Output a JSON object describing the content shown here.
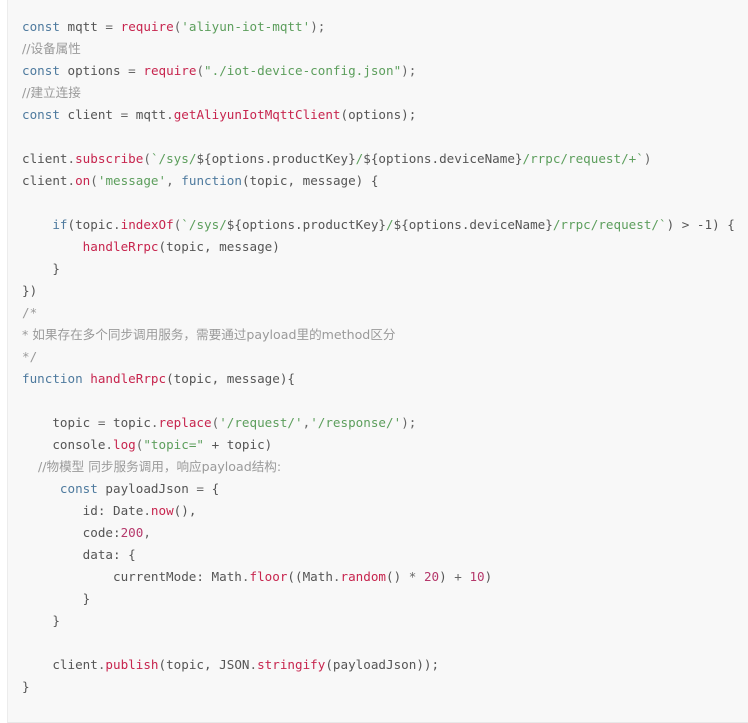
{
  "block": {
    "name": "javascript-code-block",
    "language": "javascript",
    "background": "#f8f8f8",
    "colors": {
      "keyword": "#4e7a9e",
      "function": "#c7254e",
      "string": "#5c9e5c",
      "number": "#b5386b",
      "comment": "#9a9a9a",
      "plain": "#555555"
    }
  },
  "code": {
    "lines": [
      {
        "n": 1,
        "tokens": [
          {
            "t": "const",
            "c": "kw"
          },
          {
            "t": " mqtt ",
            "c": "pl"
          },
          {
            "t": "=",
            "c": "pun"
          },
          {
            "t": " ",
            "c": "pl"
          },
          {
            "t": "require",
            "c": "fn"
          },
          {
            "t": "(",
            "c": "pun"
          },
          {
            "t": "'aliyun-iot-mqtt'",
            "c": "str"
          },
          {
            "t": ");",
            "c": "pun"
          }
        ]
      },
      {
        "n": 2,
        "tokens": [
          {
            "t": "//设备属性",
            "c": "cmt"
          }
        ]
      },
      {
        "n": 3,
        "tokens": [
          {
            "t": "const",
            "c": "kw"
          },
          {
            "t": " options ",
            "c": "pl"
          },
          {
            "t": "=",
            "c": "pun"
          },
          {
            "t": " ",
            "c": "pl"
          },
          {
            "t": "require",
            "c": "fn"
          },
          {
            "t": "(",
            "c": "pun"
          },
          {
            "t": "\"./iot-device-config.json\"",
            "c": "str"
          },
          {
            "t": ");",
            "c": "pun"
          }
        ]
      },
      {
        "n": 4,
        "tokens": [
          {
            "t": "//建立连接",
            "c": "cmt"
          }
        ]
      },
      {
        "n": 5,
        "tokens": [
          {
            "t": "const",
            "c": "kw"
          },
          {
            "t": " client ",
            "c": "pl"
          },
          {
            "t": "=",
            "c": "pun"
          },
          {
            "t": " mqtt",
            "c": "pl"
          },
          {
            "t": ".",
            "c": "pun"
          },
          {
            "t": "getAliyunIotMqttClient",
            "c": "fn"
          },
          {
            "t": "(options);",
            "c": "pl"
          }
        ]
      },
      {
        "n": 6,
        "tokens": []
      },
      {
        "n": 7,
        "tokens": [
          {
            "t": "client",
            "c": "pl"
          },
          {
            "t": ".",
            "c": "pun"
          },
          {
            "t": "subscribe",
            "c": "fn"
          },
          {
            "t": "(",
            "c": "pun"
          },
          {
            "t": "`/sys/",
            "c": "str"
          },
          {
            "t": "${options.productKey}",
            "c": "pl"
          },
          {
            "t": "/",
            "c": "str"
          },
          {
            "t": "${options.deviceName}",
            "c": "pl"
          },
          {
            "t": "/rrpc/request/+`",
            "c": "str"
          },
          {
            "t": ")",
            "c": "pun"
          }
        ]
      },
      {
        "n": 8,
        "tokens": [
          {
            "t": "client",
            "c": "pl"
          },
          {
            "t": ".",
            "c": "pun"
          },
          {
            "t": "on",
            "c": "fn"
          },
          {
            "t": "(",
            "c": "pun"
          },
          {
            "t": "'message'",
            "c": "str"
          },
          {
            "t": ", ",
            "c": "pun"
          },
          {
            "t": "function",
            "c": "kw"
          },
          {
            "t": "(topic, message) {",
            "c": "pl"
          }
        ]
      },
      {
        "n": 9,
        "tokens": []
      },
      {
        "n": 10,
        "tokens": [
          {
            "t": "    ",
            "c": "pl"
          },
          {
            "t": "if",
            "c": "kw"
          },
          {
            "t": "(topic",
            "c": "pl"
          },
          {
            "t": ".",
            "c": "pun"
          },
          {
            "t": "indexOf",
            "c": "fn"
          },
          {
            "t": "(",
            "c": "pun"
          },
          {
            "t": "`/sys/",
            "c": "str"
          },
          {
            "t": "${options.productKey}",
            "c": "pl"
          },
          {
            "t": "/",
            "c": "str"
          },
          {
            "t": "${options.deviceName}",
            "c": "pl"
          },
          {
            "t": "/rrpc/request/`",
            "c": "str"
          },
          {
            "t": ") > -1) {",
            "c": "pl"
          }
        ]
      },
      {
        "n": 11,
        "tokens": [
          {
            "t": "        ",
            "c": "pl"
          },
          {
            "t": "handleRrpc",
            "c": "fn"
          },
          {
            "t": "(topic, message)",
            "c": "pl"
          }
        ]
      },
      {
        "n": 12,
        "tokens": [
          {
            "t": "    }",
            "c": "pl"
          }
        ]
      },
      {
        "n": 13,
        "tokens": [
          {
            "t": "})",
            "c": "pl"
          }
        ]
      },
      {
        "n": 14,
        "tokens": [
          {
            "t": "/*",
            "c": "cmt"
          }
        ]
      },
      {
        "n": 15,
        "tokens": [
          {
            "t": "* 如果存在多个同步调用服务，需要通过payload里的method区分",
            "c": "cmt"
          }
        ]
      },
      {
        "n": 16,
        "tokens": [
          {
            "t": "*/",
            "c": "cmt"
          }
        ]
      },
      {
        "n": 17,
        "tokens": [
          {
            "t": "function",
            "c": "kw"
          },
          {
            "t": " ",
            "c": "pl"
          },
          {
            "t": "handleRrpc",
            "c": "fn"
          },
          {
            "t": "(topic, message){",
            "c": "pl"
          }
        ]
      },
      {
        "n": 18,
        "tokens": []
      },
      {
        "n": 19,
        "tokens": [
          {
            "t": "    topic ",
            "c": "pl"
          },
          {
            "t": "=",
            "c": "pun"
          },
          {
            "t": " topic",
            "c": "pl"
          },
          {
            "t": ".",
            "c": "pun"
          },
          {
            "t": "replace",
            "c": "fn"
          },
          {
            "t": "(",
            "c": "pun"
          },
          {
            "t": "'/request/'",
            "c": "str"
          },
          {
            "t": ",",
            "c": "pun"
          },
          {
            "t": "'/response/'",
            "c": "str"
          },
          {
            "t": ");",
            "c": "pun"
          }
        ]
      },
      {
        "n": 20,
        "tokens": [
          {
            "t": "    console",
            "c": "pl"
          },
          {
            "t": ".",
            "c": "pun"
          },
          {
            "t": "log",
            "c": "fn"
          },
          {
            "t": "(",
            "c": "pun"
          },
          {
            "t": "\"topic=\"",
            "c": "str"
          },
          {
            "t": " + topic)",
            "c": "pl"
          }
        ]
      },
      {
        "n": 21,
        "tokens": [
          {
            "t": "    //物模型 同步服务调用，响应payload结构:",
            "c": "cmt"
          }
        ]
      },
      {
        "n": 22,
        "tokens": [
          {
            "t": "     ",
            "c": "pl"
          },
          {
            "t": "const",
            "c": "kw"
          },
          {
            "t": " payloadJson ",
            "c": "pl"
          },
          {
            "t": "=",
            "c": "pun"
          },
          {
            "t": " {",
            "c": "pl"
          }
        ]
      },
      {
        "n": 23,
        "tokens": [
          {
            "t": "        id: Date",
            "c": "pl"
          },
          {
            "t": ".",
            "c": "pun"
          },
          {
            "t": "now",
            "c": "fn"
          },
          {
            "t": "(),",
            "c": "pl"
          }
        ]
      },
      {
        "n": 24,
        "tokens": [
          {
            "t": "        code:",
            "c": "pl"
          },
          {
            "t": "200",
            "c": "num"
          },
          {
            "t": ",",
            "c": "pun"
          }
        ]
      },
      {
        "n": 25,
        "tokens": [
          {
            "t": "        data: {",
            "c": "pl"
          }
        ]
      },
      {
        "n": 26,
        "tokens": [
          {
            "t": "            currentMode: Math",
            "c": "pl"
          },
          {
            "t": ".",
            "c": "pun"
          },
          {
            "t": "floor",
            "c": "fn"
          },
          {
            "t": "((Math",
            "c": "pl"
          },
          {
            "t": ".",
            "c": "pun"
          },
          {
            "t": "random",
            "c": "fn"
          },
          {
            "t": "() ",
            "c": "pl"
          },
          {
            "t": "*",
            "c": "pun"
          },
          {
            "t": " ",
            "c": "pl"
          },
          {
            "t": "20",
            "c": "num"
          },
          {
            "t": ") ",
            "c": "pl"
          },
          {
            "t": "+",
            "c": "pun"
          },
          {
            "t": " ",
            "c": "pl"
          },
          {
            "t": "10",
            "c": "num"
          },
          {
            "t": ")",
            "c": "pl"
          }
        ]
      },
      {
        "n": 27,
        "tokens": [
          {
            "t": "        }",
            "c": "pl"
          }
        ]
      },
      {
        "n": 28,
        "tokens": [
          {
            "t": "    }",
            "c": "pl"
          }
        ]
      },
      {
        "n": 29,
        "tokens": []
      },
      {
        "n": 30,
        "tokens": [
          {
            "t": "    client",
            "c": "pl"
          },
          {
            "t": ".",
            "c": "pun"
          },
          {
            "t": "publish",
            "c": "fn"
          },
          {
            "t": "(topic, JSON",
            "c": "pl"
          },
          {
            "t": ".",
            "c": "pun"
          },
          {
            "t": "stringify",
            "c": "fn"
          },
          {
            "t": "(payloadJson));",
            "c": "pl"
          }
        ]
      },
      {
        "n": 31,
        "tokens": [
          {
            "t": "}",
            "c": "pl"
          }
        ]
      }
    ]
  }
}
